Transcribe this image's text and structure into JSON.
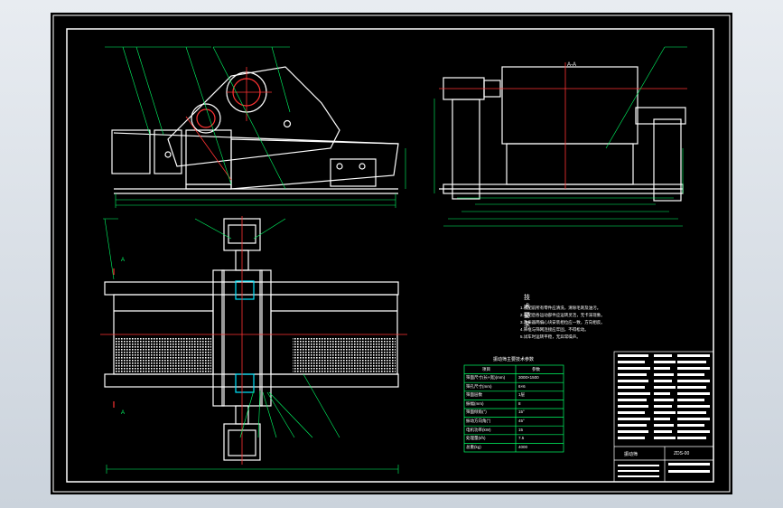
{
  "section_labels": {
    "a_a": "A-A",
    "a_top": "A",
    "a_bottom": "A"
  },
  "notes": {
    "title": "技术要求",
    "lines": [
      "1.装配前所有零件应清洗，清除毛刺及油污。",
      "2.装配后各运动部件应运转灵活，无卡滞现象。",
      "3.激振器两偏心块安装相位应一致，方向相反。",
      "4.筛框与筛网连接应牢固，不得松动。",
      "5.试车时运转平稳，无异常噪声。"
    ]
  },
  "param_table": {
    "title": "振动筛主要技术参数",
    "header": [
      "项目",
      "参数"
    ],
    "rows": [
      [
        "筛面尺寸(长×宽)(mm)",
        "3000×1500"
      ],
      [
        "筛孔尺寸(mm)",
        "6×6"
      ],
      [
        "筛面层数",
        "1层"
      ],
      [
        "振幅(mm)",
        "8"
      ],
      [
        "筛面倾角(°)",
        "15°"
      ],
      [
        "振动方向角(°)",
        "45°"
      ],
      [
        "电机功率(kW)",
        "15"
      ],
      [
        "处理量(t/h)",
        "7.5"
      ],
      [
        "总重(kg)",
        "4000"
      ]
    ]
  },
  "title_block": {
    "name": "振动筛",
    "drawing_no": "ZDS-00"
  },
  "colors": {
    "outline": "#ffffff",
    "dim": "#00ff66",
    "center": "#ff3333",
    "hatch": "#00e5ff",
    "panel": "#000000"
  }
}
